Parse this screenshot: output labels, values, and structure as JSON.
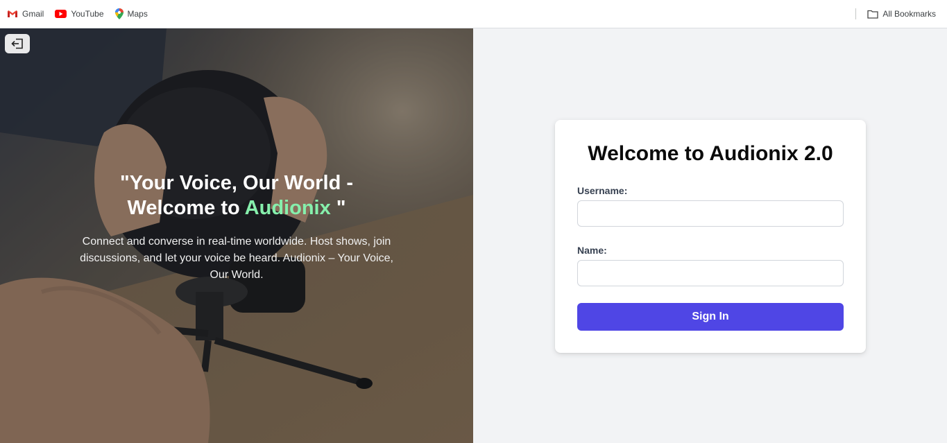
{
  "bookmarks": {
    "items": [
      {
        "label": "Gmail",
        "icon": "gmail-icon"
      },
      {
        "label": "YouTube",
        "icon": "youtube-icon"
      },
      {
        "label": "Maps",
        "icon": "maps-icon"
      }
    ],
    "all_bookmarks_label": "All Bookmarks"
  },
  "hero": {
    "exit_icon": "exit-icon",
    "title_part1": "\"Your Voice, Our World -",
    "title_part2": "Welcome to ",
    "title_accent": "Audionix",
    "title_part3": " \"",
    "description": "Connect and converse in real-time worldwide. Host shows, join discussions, and let your voice be heard. Audionix – Your Voice, Our World.",
    "accent_color": "#86efac"
  },
  "login": {
    "title": "Welcome to Audionix 2.0",
    "username_label": "Username:",
    "username_value": "",
    "name_label": "Name:",
    "name_value": "",
    "submit_label": "Sign In",
    "button_color": "#4f46e5"
  }
}
